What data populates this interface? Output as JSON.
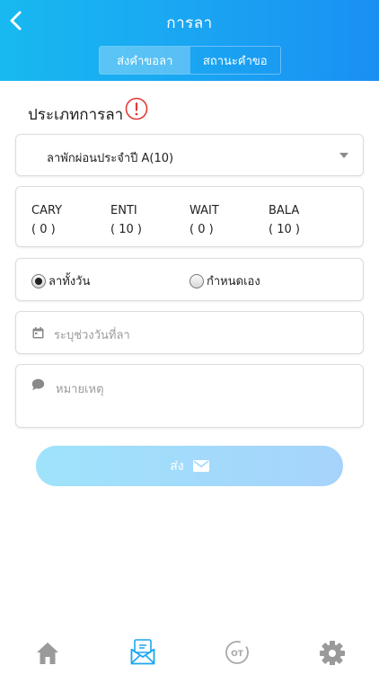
{
  "header": {
    "title": "การลา",
    "tabs": [
      {
        "label": "ส่งคำขอลา",
        "active": true
      },
      {
        "label": "สถานะคำขอ",
        "active": false
      }
    ]
  },
  "form": {
    "leave_type_title": "ประเภทการลา",
    "alert_icon": "exclamation-circle-icon",
    "leave_type_selected": "ลาพักผ่อนประจำปี A(10)",
    "balances": [
      {
        "label": "CARY",
        "value": "( 0 )"
      },
      {
        "label": "ENTI",
        "value": "( 10 )"
      },
      {
        "label": "WAIT",
        "value": "( 0 )"
      },
      {
        "label": "BALA",
        "value": "( 10 )"
      }
    ],
    "duration_options": [
      {
        "label": "ลาทั้งวัน",
        "checked": true
      },
      {
        "label": "กำหนดเอง",
        "checked": false
      }
    ],
    "date_placeholder": "ระบุช่วงวันที่ลา",
    "note_placeholder": "หมายเหตุ",
    "submit_label": "ส่ง"
  },
  "bottom_nav": {
    "items": [
      "home-icon",
      "leave-envelope-icon",
      "ot-icon",
      "settings-gear-icon"
    ],
    "active_index": 1
  },
  "colors": {
    "header_gradient": [
      "#18b9f0",
      "#1a8ff3"
    ],
    "accent": "#1aa6f2",
    "alert": "#e53935",
    "submit_gradient": [
      "#9fe3fb",
      "#a6d3fb"
    ]
  }
}
